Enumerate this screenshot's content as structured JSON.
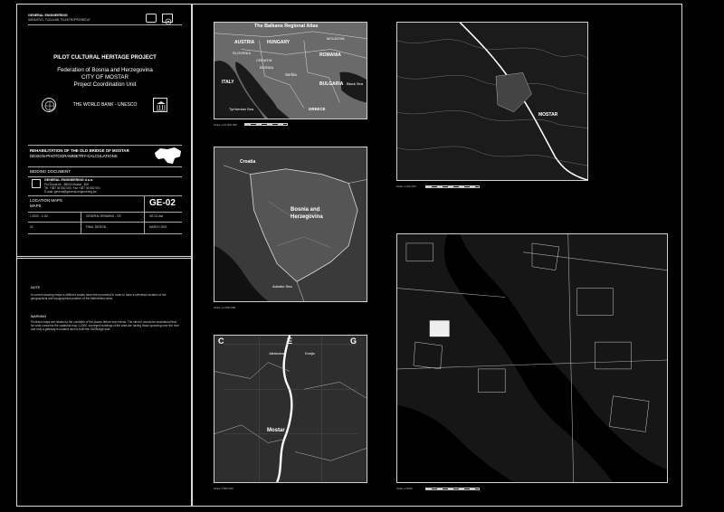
{
  "company_header": {
    "name": "GENERAL ENGINEERING",
    "sub": "SARAJEVO, TUZLA BB, \"ELEKTROPRIVREDA\""
  },
  "project": {
    "title": "PILOT CULTURAL HERITAGE PROJECT",
    "line1": "Federation of Bosnia and Herzegovina",
    "line2": "CITY OF MOSTAR",
    "line3": "Project Coordination Unit",
    "funders": "THE WORLD BANK - UNESCO"
  },
  "subject": {
    "line1": "REHABILITATION OF THE OLD BRIDGE OF MOSTAR",
    "line2": "DESIGN-PHOTOGRAMMETRY-CALCULATIONS"
  },
  "document": {
    "type": "BIDDING DOCUMENT",
    "company": "GENERAL ENGINEERING d.o.o.",
    "address1": "Put Života bb - 88000 Mostar - BiH",
    "address2": "Tel. +387 36 552 000, Fax +387 36 552 001",
    "address3": "E-mail: general@general-engineering.ba"
  },
  "drawing": {
    "title1": "LOCATION MAPS",
    "title2": "MAPS",
    "code": "GE-02",
    "scale": "1:2000 - 1:1M",
    "kind": "GENERAL DRAWING - GE",
    "file": "GE-02.dwf",
    "number": "02",
    "phase": "FINAL DESIGN",
    "date": "MARCH 2001"
  },
  "notes": {
    "note_heading": "NOTE",
    "note_text1": "In current drawing maps in different scales have been provided in order to have a reference location of the",
    "note_text2": "geographical and topographical position of the intervention area.",
    "warning_heading": "WARNING",
    "warning_text1": "Provided maps are related to the condition of the places before war events. The client it should be understood that,",
    "warning_text2": "for what concerns the cadastral map 1:2000, surveyed buildings of the area are having those spanning over the river",
    "warning_text3": "and only a gateway is located next to both the Old Bridge side."
  },
  "maps": {
    "balkans_title": "The Balkans Regional Atlas",
    "balkans_labels": [
      "AUSTRIA",
      "HUNGARY",
      "ROMANIA",
      "SLOVENIA",
      "CROATIA",
      "BOSNIA",
      "Serbia",
      "MOLDOVA",
      "BULGARIA",
      "ITALY",
      "Black Sea",
      "Tyrrhenian Sea",
      "GREECE"
    ],
    "bosnia_labels": [
      "Bosnia and",
      "Herzegovina",
      "Croatia",
      "Adriatic Sea"
    ],
    "region_labels": [
      "C",
      "E",
      "G",
      "Mostar",
      "Jablanica",
      "Konjic"
    ],
    "city_label": "MOSTAR",
    "scale_balkans": "Scale 1:10 000 000",
    "scale_bosnia": "Scale 1:2 000 000",
    "scale_region": "Scale 1:500 000",
    "scale_topo": "Scale 1:100 000",
    "scale_cadastral": "Scale 1:2000"
  },
  "colors": {
    "background": "#000000",
    "line": "#ffffff",
    "frame": "#d8d8d8"
  }
}
